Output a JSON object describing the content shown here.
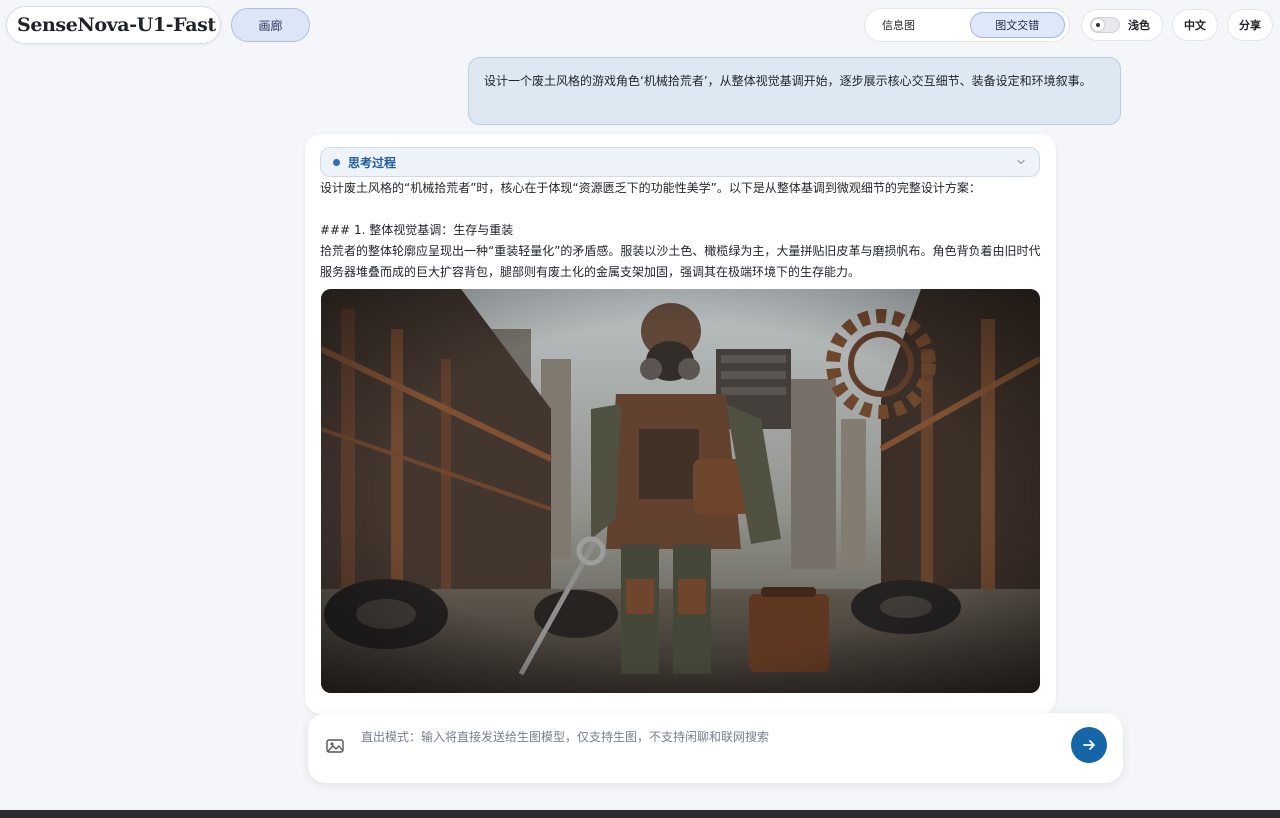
{
  "header": {
    "model_name": "SenseNova-U1-Fast",
    "gallery_label": "画廊",
    "modes": [
      "信息图",
      "图文交错"
    ],
    "active_mode": "图文交错",
    "theme_label": "浅色",
    "lang_label": "中文",
    "share_label": "分享"
  },
  "conversation": {
    "user_message": "设计一个废土风格的游戏角色‘机械拾荒者’，从整体视觉基调开始，逐步展示核心交互细节、装备设定和环境叙事。",
    "thinking_label": "思考过程",
    "answer_intro": "设计废土风格的“机械拾荒者”时，核心在于体现“资源匮乏下的功能性美学”。以下是从整体基调到微观细节的完整设计方案：",
    "section_heading": "### 1. 整体视觉基调：生存与重装",
    "section_body": "拾荒者的整体轮廓应呈现出一种“重装轻量化”的矛盾感。服装以沙土色、橄榄绿为主，大量拼贴旧皮革与磨损帆布。角色背负着由旧时代服务器堆叠而成的巨大扩容背包，腿部则有废土化的金属支架加固，强调其在极端环境下的生存能力。"
  },
  "composer": {
    "placeholder": "直出模式：输入将直接发送给生图模型，仅支持生图，不支持闲聊和联网搜索",
    "value": ""
  },
  "icons": {
    "model_dropdown": "chevron-down-icon",
    "theme": "sun-icon",
    "thinking_toggle": "chevron-down-icon",
    "image_upload": "image-icon",
    "send": "arrow-right-icon"
  },
  "colors": {
    "accent": "#1565a8",
    "page_background": "#f4f6f9",
    "user_bubble": "#dde8f3"
  }
}
